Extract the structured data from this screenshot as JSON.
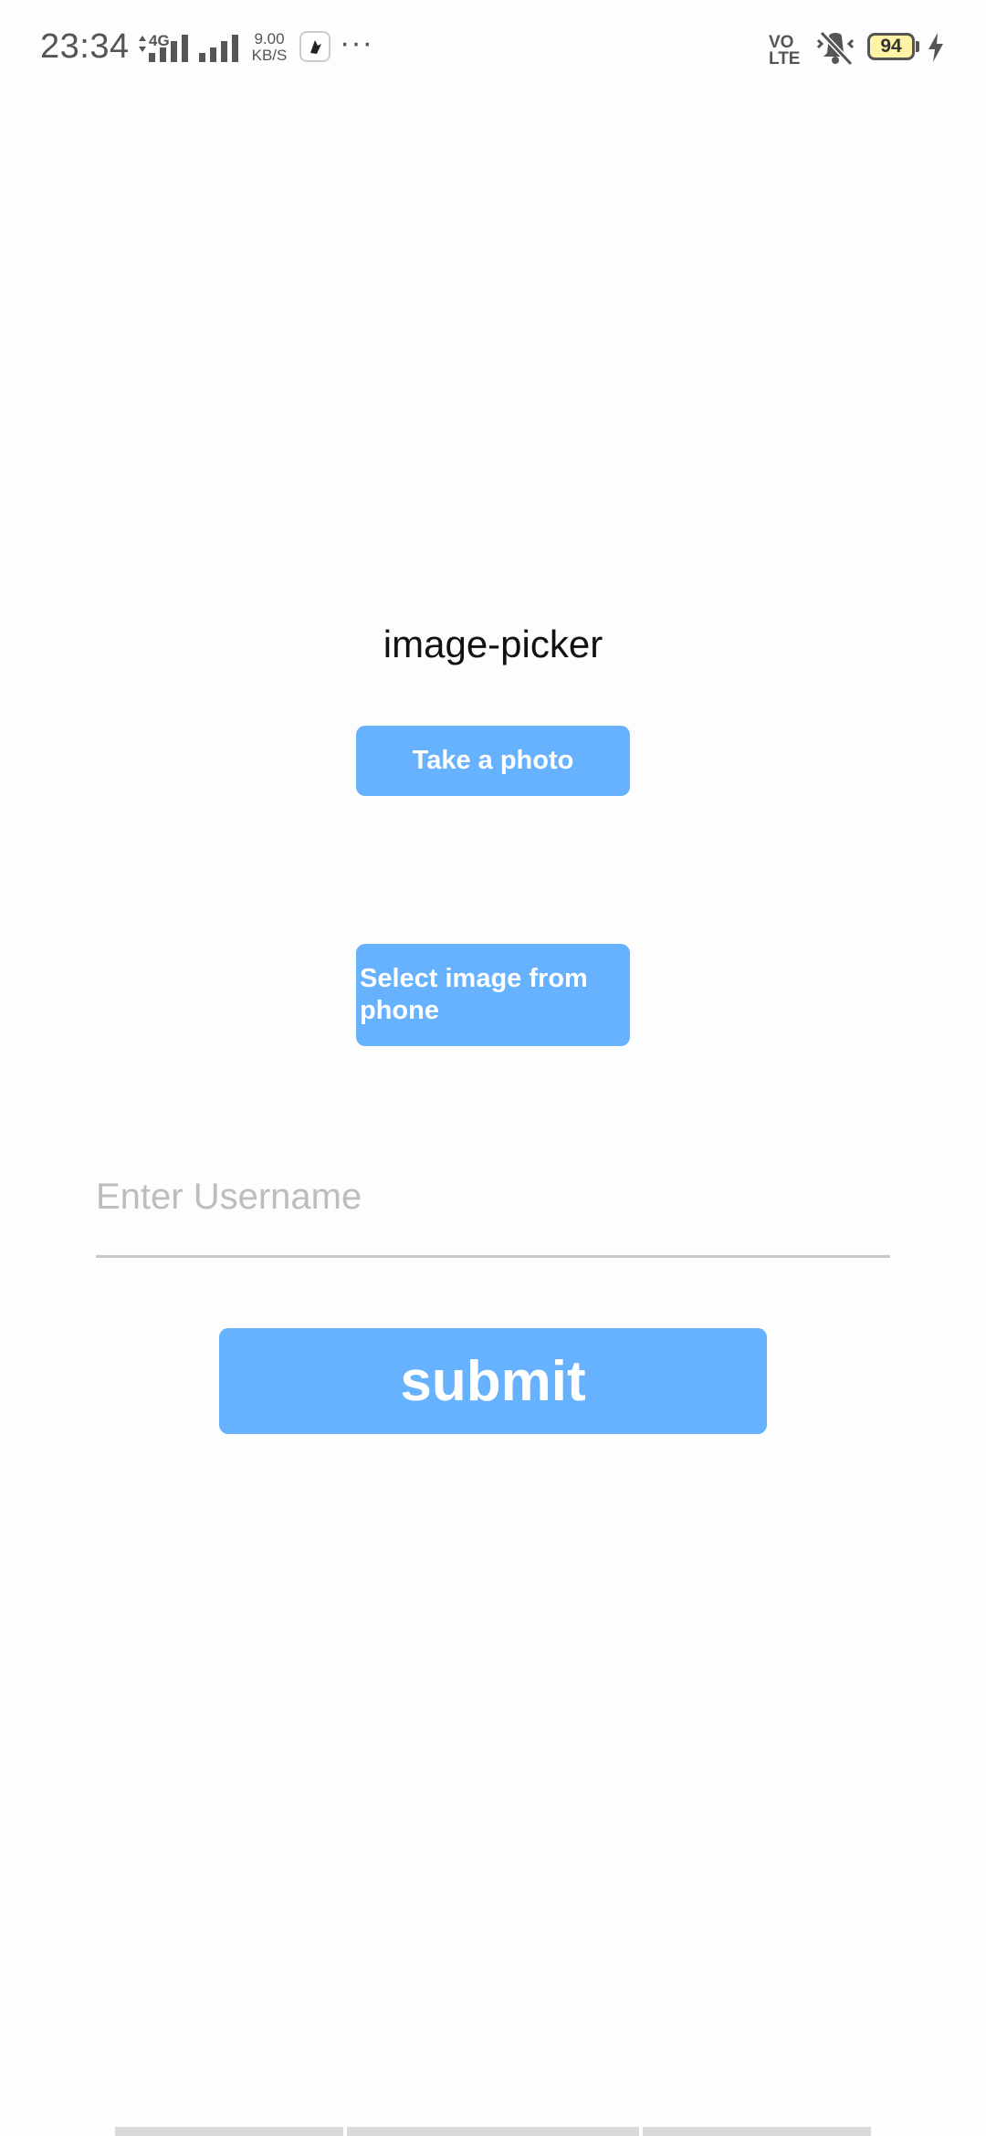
{
  "status_bar": {
    "time": "23:34",
    "network_type": "4G",
    "speed_value": "9.00",
    "speed_unit": "KB/S",
    "more": "···",
    "volte_top": "VO",
    "volte_bottom": "LTE",
    "battery": "94",
    "icons": [
      "data-arrows-icon",
      "signal-icon",
      "signal-icon",
      "app-notification-icon",
      "vibrate-mute-icon",
      "charging-icon"
    ]
  },
  "app": {
    "title": "image-picker",
    "take_photo_label": "Take a photo",
    "select_image_label": "Select image from phone",
    "username_placeholder": "Enter Username",
    "username_value": "",
    "submit_label": "submit"
  },
  "colors": {
    "button": "#66b2ff",
    "button_text": "#ffffff",
    "background": "#fdfdfd",
    "battery_fill": "#fff3a6"
  }
}
